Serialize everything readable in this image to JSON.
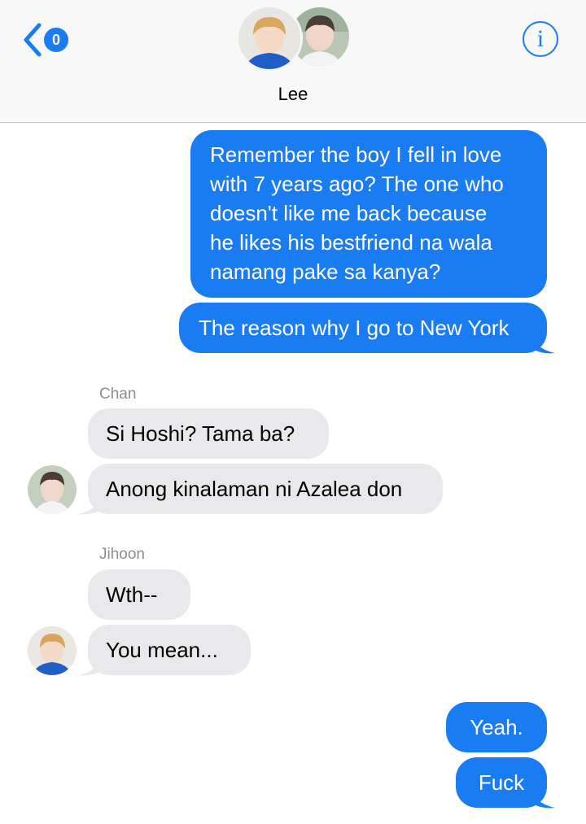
{
  "header": {
    "back_badge": "0",
    "contact_name": "Lee",
    "info_label": "i"
  },
  "messages": [
    {
      "from": "me",
      "text": "Remember the boy I fell in love with 7 years ago? The one who doesn't like me back because he likes his bestfriend na wala namang pake sa kanya?",
      "lines": [
        "Remember the boy I fell in love",
        "with 7 years ago? The one who",
        "doesn't like me back because",
        "he likes his bestfriend na wala",
        "namang pake sa kanya?"
      ]
    },
    {
      "from": "me",
      "text": "The reason why I go to New York"
    },
    {
      "from": "Chan",
      "sender_label": "Chan",
      "text": "Si Hoshi? Tama ba?"
    },
    {
      "from": "Chan",
      "text": "Anong kinalaman ni Azalea don"
    },
    {
      "from": "Jihoon",
      "sender_label": "Jihoon",
      "text": "Wth--"
    },
    {
      "from": "Jihoon",
      "text": "You mean..."
    },
    {
      "from": "me",
      "text": "Yeah."
    },
    {
      "from": "me",
      "text": "Fuck"
    }
  ],
  "colors": {
    "sent_bubble": "#1a7cf2",
    "received_bubble": "#e9e9eb",
    "accent": "#1a7cf2",
    "sender_name": "#8e8e93"
  },
  "icons": {
    "back": "chevron-left-icon",
    "info": "info-icon"
  }
}
